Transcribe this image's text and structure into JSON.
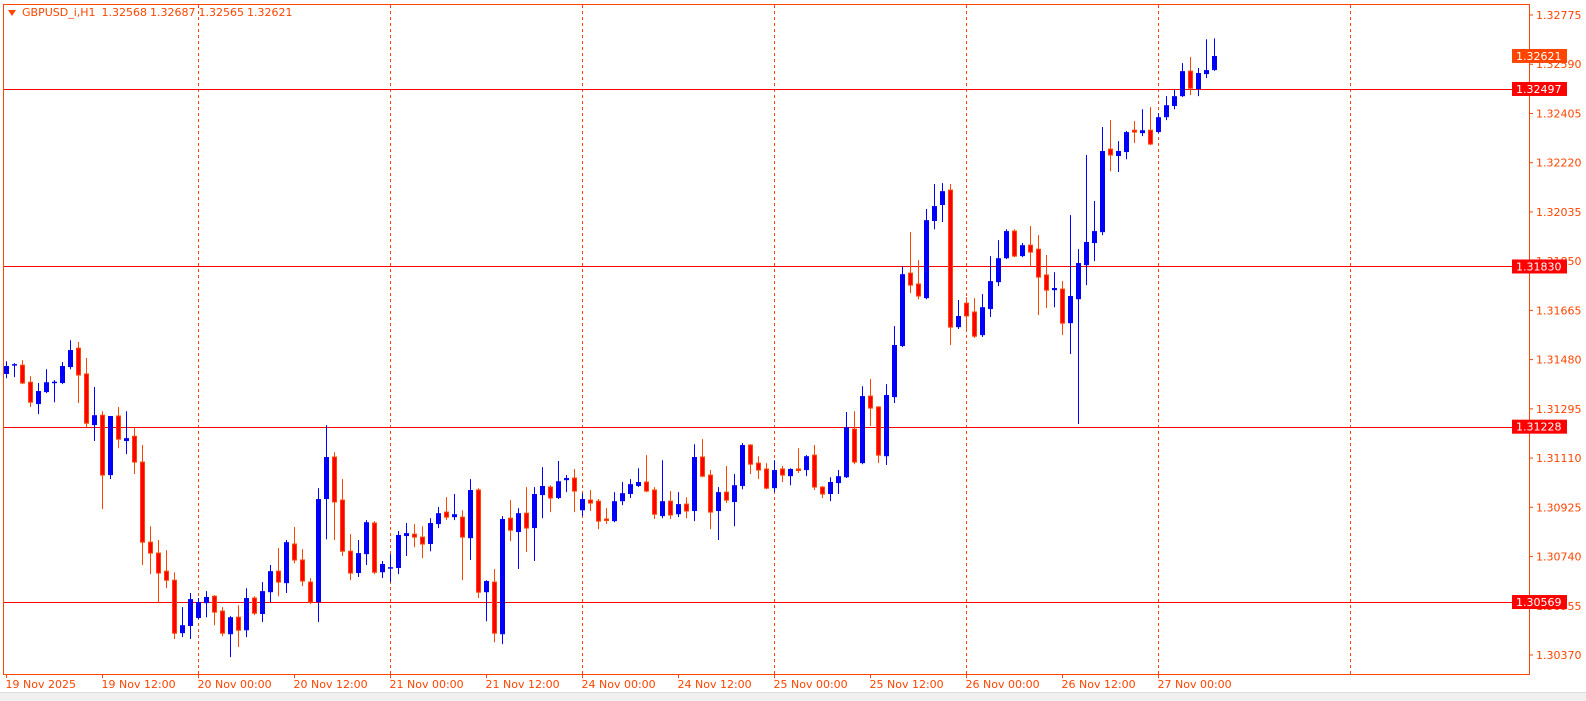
{
  "header": {
    "symbol": "GBPUSD_i,H1",
    "open": "1.32568",
    "high": "1.32687",
    "low": "1.32565",
    "close": "1.32621"
  },
  "colors": {
    "frame": "#FF4500",
    "bull": "#0000FF",
    "bear_fill": "#FF0000",
    "bear_outline": "#FF4500",
    "level_line": "#FF0000",
    "bid_label": "#FF4500",
    "background": "#FFFFFF"
  },
  "chart_data": {
    "type": "candlestick",
    "symbol": "GBPUSD_i",
    "timeframe": "H1",
    "ylim": [
      1.30355,
      1.32831
    ],
    "grid": false,
    "y_ticks": [
      "1.32775",
      "1.32590",
      "1.32405",
      "1.32220",
      "1.32035",
      "1.31850",
      "1.31665",
      "1.31480",
      "1.31295",
      "1.31110",
      "1.30925",
      "1.30740",
      "1.30555",
      "1.30370"
    ],
    "x_tick_labels": [
      "19 Nov 2025",
      "19 Nov 12:00",
      "20 Nov 00:00",
      "20 Nov 12:00",
      "21 Nov 00:00",
      "21 Nov 12:00",
      "24 Nov 00:00",
      "24 Nov 12:00",
      "25 Nov 00:00",
      "25 Nov 12:00",
      "26 Nov 00:00",
      "26 Nov 12:00",
      "27 Nov 00:00"
    ],
    "day_separators": [
      "20 Nov 00:00",
      "21 Nov 00:00",
      "24 Nov 00:00",
      "25 Nov 00:00",
      "26 Nov 00:00",
      "27 Nov 00:00",
      "28 Nov 00:00"
    ],
    "horizontal_levels": [
      {
        "price": 1.32497,
        "label": "1.32497"
      },
      {
        "price": 1.3183,
        "label": "1.31830"
      },
      {
        "price": 1.31228,
        "label": "1.31228"
      },
      {
        "price": 1.30569,
        "label": "1.30569"
      }
    ],
    "bid": {
      "price": 1.32621,
      "label": "1.32621"
    },
    "candles_columns": [
      "time",
      "open",
      "high",
      "low",
      "close"
    ],
    "candles": [
      [
        "19 Nov 00:00",
        1.31426,
        1.31474,
        1.3141,
        1.31456
      ],
      [
        "19 Nov 01:00",
        1.31461,
        1.31467,
        1.31414,
        1.31463
      ],
      [
        "19 Nov 02:00",
        1.31459,
        1.31478,
        1.31388,
        1.31392
      ],
      [
        "19 Nov 03:00",
        1.31395,
        1.31418,
        1.31302,
        1.3132
      ],
      [
        "19 Nov 04:00",
        1.31313,
        1.31392,
        1.31275,
        1.31362
      ],
      [
        "19 Nov 05:00",
        1.31358,
        1.31444,
        1.31354,
        1.31395
      ],
      [
        "19 Nov 06:00",
        1.31395,
        1.31403,
        1.3132,
        1.31397
      ],
      [
        "19 Nov 07:00",
        1.31392,
        1.31471,
        1.31388,
        1.31456
      ],
      [
        "19 Nov 08:00",
        1.31452,
        1.31553,
        1.31444,
        1.31516
      ],
      [
        "19 Nov 09:00",
        1.31523,
        1.31546,
        1.31317,
        1.31422
      ],
      [
        "19 Nov 10:00",
        1.31426,
        1.31486,
        1.31226,
        1.31241
      ],
      [
        "19 Nov 11:00",
        1.31234,
        1.31377,
        1.31174,
        1.31271
      ],
      [
        "19 Nov 12:00",
        1.31271,
        1.31286,
        1.30918,
        1.31046
      ],
      [
        "19 Nov 13:00",
        1.31046,
        1.31268,
        1.31031,
        1.31268
      ],
      [
        "19 Nov 14:00",
        1.31268,
        1.31302,
        1.31147,
        1.31181
      ],
      [
        "19 Nov 15:00",
        1.31174,
        1.31286,
        1.31125,
        1.31185
      ],
      [
        "19 Nov 16:00",
        1.31192,
        1.31226,
        1.3105,
        1.31095
      ],
      [
        "19 Nov 17:00",
        1.31095,
        1.31159,
        1.30708,
        1.30794
      ],
      [
        "19 Nov 18:00",
        1.30794,
        1.30854,
        1.30674,
        1.30753
      ],
      [
        "19 Nov 19:00",
        1.30753,
        1.30802,
        1.30565,
        1.30678
      ],
      [
        "19 Nov 20:00",
        1.30685,
        1.30764,
        1.30621,
        1.30651
      ],
      [
        "19 Nov 21:00",
        1.30651,
        1.30681,
        1.3043,
        1.30452
      ],
      [
        "19 Nov 22:00",
        1.30452,
        1.3055,
        1.30437,
        1.30482
      ],
      [
        "19 Nov 23:00",
        1.30479,
        1.30603,
        1.3043,
        1.3058
      ],
      [
        "20 Nov 00:00",
        1.30509,
        1.30584,
        1.30505,
        1.30569
      ],
      [
        "20 Nov 01:00",
        1.30565,
        1.3061,
        1.30512,
        1.30588
      ],
      [
        "20 Nov 02:00",
        1.30591,
        1.30595,
        1.30482,
        1.30531
      ],
      [
        "20 Nov 03:00",
        1.30535,
        1.3055,
        1.30441,
        1.30452
      ],
      [
        "20 Nov 04:00",
        1.30448,
        1.30516,
        1.30362,
        1.30512
      ],
      [
        "20 Nov 05:00",
        1.30512,
        1.30557,
        1.304,
        1.30463
      ],
      [
        "20 Nov 06:00",
        1.30463,
        1.30621,
        1.30437,
        1.30584
      ],
      [
        "20 Nov 07:00",
        1.30584,
        1.30591,
        1.3052,
        1.30527
      ],
      [
        "20 Nov 08:00",
        1.30524,
        1.30644,
        1.30494,
        1.3061
      ],
      [
        "20 Nov 09:00",
        1.30606,
        1.30708,
        1.30569,
        1.30685
      ],
      [
        "20 Nov 10:00",
        1.30685,
        1.30772,
        1.30591,
        1.30644
      ],
      [
        "20 Nov 11:00",
        1.3064,
        1.30802,
        1.30603,
        1.30794
      ],
      [
        "20 Nov 12:00",
        1.30787,
        1.30851,
        1.30715,
        1.30727
      ],
      [
        "20 Nov 13:00",
        1.30727,
        1.30768,
        1.30629,
        1.30648
      ],
      [
        "20 Nov 14:00",
        1.30644,
        1.30659,
        1.30561,
        1.30569
      ],
      [
        "20 Nov 15:00",
        1.30569,
        1.30997,
        1.30494,
        1.30956
      ],
      [
        "20 Nov 16:00",
        1.30956,
        1.31234,
        1.30805,
        1.31114
      ],
      [
        "20 Nov 17:00",
        1.31114,
        1.31132,
        1.30802,
        1.30945
      ],
      [
        "20 Nov 18:00",
        1.30952,
        1.31031,
        1.30742,
        1.3076
      ],
      [
        "20 Nov 19:00",
        1.3076,
        1.30824,
        1.30651,
        1.30678
      ],
      [
        "20 Nov 20:00",
        1.30678,
        1.30802,
        1.30663,
        1.30753
      ],
      [
        "20 Nov 21:00",
        1.30749,
        1.30877,
        1.30708,
        1.30869
      ],
      [
        "20 Nov 22:00",
        1.30866,
        1.30873,
        1.30674,
        1.30681
      ],
      [
        "20 Nov 23:00",
        1.30681,
        1.30723,
        1.30659,
        1.30712
      ],
      [
        "21 Nov 00:00",
        1.30697,
        1.30749,
        1.30644,
        1.307
      ],
      [
        "21 Nov 01:00",
        1.30697,
        1.30836,
        1.30674,
        1.30821
      ],
      [
        "21 Nov 02:00",
        1.30817,
        1.30866,
        1.30742,
        1.30828
      ],
      [
        "21 Nov 03:00",
        1.30824,
        1.30862,
        1.30775,
        1.30813
      ],
      [
        "21 Nov 04:00",
        1.30813,
        1.30854,
        1.30734,
        1.30787
      ],
      [
        "21 Nov 05:00",
        1.30787,
        1.30884,
        1.3076,
        1.30866
      ],
      [
        "21 Nov 06:00",
        1.30862,
        1.30926,
        1.30847,
        1.30903
      ],
      [
        "21 Nov 07:00",
        1.30907,
        1.30963,
        1.30877,
        1.30888
      ],
      [
        "21 Nov 08:00",
        1.30888,
        1.30975,
        1.30877,
        1.30899
      ],
      [
        "21 Nov 09:00",
        1.30888,
        1.30914,
        1.30651,
        1.30813
      ],
      [
        "21 Nov 10:00",
        1.30809,
        1.31031,
        1.30727,
        1.3099
      ],
      [
        "21 Nov 11:00",
        1.3099,
        1.30997,
        1.30584,
        1.30606
      ],
      [
        "21 Nov 12:00",
        1.30606,
        1.30651,
        1.30497,
        1.30648
      ],
      [
        "21 Nov 13:00",
        1.30644,
        1.30693,
        1.30418,
        1.30452
      ],
      [
        "21 Nov 14:00",
        1.30448,
        1.30892,
        1.30411,
        1.30881
      ],
      [
        "21 Nov 15:00",
        1.30884,
        1.30952,
        1.30798,
        1.30839
      ],
      [
        "21 Nov 16:00",
        1.30832,
        1.30922,
        1.30693,
        1.30903
      ],
      [
        "21 Nov 17:00",
        1.30903,
        1.31001,
        1.30757,
        1.30847
      ],
      [
        "21 Nov 18:00",
        1.30847,
        1.31001,
        1.30723,
        1.30975
      ],
      [
        "21 Nov 19:00",
        1.30971,
        1.31076,
        1.30884,
        1.31005
      ],
      [
        "21 Nov 20:00",
        1.31001,
        1.31008,
        1.30907,
        1.3096
      ],
      [
        "21 Nov 21:00",
        1.3096,
        1.31099,
        1.30956,
        1.31023
      ],
      [
        "21 Nov 22:00",
        1.31027,
        1.31046,
        1.30982,
        1.31035
      ],
      [
        "21 Nov 23:00",
        1.31035,
        1.31069,
        1.30907,
        1.30986
      ],
      [
        "24 Nov 00:00",
        1.30914,
        1.30978,
        1.30892,
        1.30956
      ],
      [
        "24 Nov 01:00",
        1.30952,
        1.3099,
        1.30911,
        1.30941
      ],
      [
        "24 Nov 02:00",
        1.30948,
        1.30956,
        1.30843,
        1.30873
      ],
      [
        "24 Nov 03:00",
        1.30881,
        1.30922,
        1.30862,
        1.30879
      ],
      [
        "24 Nov 04:00",
        1.30873,
        1.30982,
        1.30869,
        1.30948
      ],
      [
        "24 Nov 05:00",
        1.30948,
        1.3102,
        1.30933,
        1.30978
      ],
      [
        "24 Nov 06:00",
        1.30975,
        1.31031,
        1.3096,
        1.31012
      ],
      [
        "24 Nov 07:00",
        1.31005,
        1.31072,
        1.31001,
        1.3102
      ],
      [
        "24 Nov 08:00",
        1.3102,
        1.31121,
        1.30982,
        1.30986
      ],
      [
        "24 Nov 09:00",
        1.3099,
        1.31001,
        1.30881,
        1.30899
      ],
      [
        "24 Nov 10:00",
        1.30892,
        1.31102,
        1.30884,
        1.30948
      ],
      [
        "24 Nov 11:00",
        1.30948,
        1.30986,
        1.30881,
        1.30896
      ],
      [
        "24 Nov 12:00",
        1.30899,
        1.30982,
        1.30888,
        1.30937
      ],
      [
        "24 Nov 13:00",
        1.30937,
        1.30963,
        1.30884,
        1.30911
      ],
      [
        "24 Nov 14:00",
        1.30911,
        1.31162,
        1.30873,
        1.31114
      ],
      [
        "24 Nov 15:00",
        1.31114,
        1.31181,
        1.31038,
        1.31042
      ],
      [
        "24 Nov 16:00",
        1.31046,
        1.31065,
        1.30843,
        1.30907
      ],
      [
        "24 Nov 17:00",
        1.30911,
        1.31001,
        1.30802,
        1.30982
      ],
      [
        "24 Nov 18:00",
        1.30982,
        1.3108,
        1.30941,
        1.30952
      ],
      [
        "24 Nov 19:00",
        1.30945,
        1.3105,
        1.30854,
        1.31008
      ],
      [
        "24 Nov 20:00",
        1.31005,
        1.31166,
        1.30993,
        1.31159
      ],
      [
        "24 Nov 21:00",
        1.31159,
        1.31162,
        1.3105,
        1.31087
      ],
      [
        "24 Nov 22:00",
        1.31091,
        1.31117,
        1.31031,
        1.31065
      ],
      [
        "24 Nov 23:00",
        1.31069,
        1.31091,
        1.30993,
        1.30997
      ],
      [
        "25 Nov 00:00",
        1.30997,
        1.31102,
        1.30982,
        1.31065
      ],
      [
        "25 Nov 01:00",
        1.31069,
        1.3108,
        1.3102,
        1.31046
      ],
      [
        "25 Nov 02:00",
        1.31042,
        1.31072,
        1.31008,
        1.31069
      ],
      [
        "25 Nov 03:00",
        1.31069,
        1.31147,
        1.31054,
        1.31067
      ],
      [
        "25 Nov 04:00",
        1.31065,
        1.31121,
        1.31042,
        1.31117
      ],
      [
        "25 Nov 05:00",
        1.31121,
        1.31159,
        1.3099,
        1.31001
      ],
      [
        "25 Nov 06:00",
        1.31001,
        1.31005,
        1.3096,
        1.30975
      ],
      [
        "25 Nov 07:00",
        1.30975,
        1.31038,
        1.30948,
        1.3102
      ],
      [
        "25 Nov 08:00",
        1.31016,
        1.31065,
        1.30975,
        1.31042
      ],
      [
        "25 Nov 09:00",
        1.31038,
        1.31283,
        1.31035,
        1.31226
      ],
      [
        "25 Nov 10:00",
        1.31219,
        1.31286,
        1.31087,
        1.31095
      ],
      [
        "25 Nov 11:00",
        1.31091,
        1.3138,
        1.31087,
        1.31343
      ],
      [
        "25 Nov 12:00",
        1.31343,
        1.31407,
        1.3123,
        1.31298
      ],
      [
        "25 Nov 13:00",
        1.31302,
        1.31305,
        1.31091,
        1.31121
      ],
      [
        "25 Nov 14:00",
        1.31117,
        1.31388,
        1.31084,
        1.31347
      ],
      [
        "25 Nov 15:00",
        1.31339,
        1.31606,
        1.31317,
        1.31535
      ],
      [
        "25 Nov 16:00",
        1.31531,
        1.31831,
        1.31527,
        1.31801
      ],
      [
        "25 Nov 17:00",
        1.31805,
        1.31959,
        1.3173,
        1.3176
      ],
      [
        "25 Nov 18:00",
        1.31764,
        1.31854,
        1.31707,
        1.31719
      ],
      [
        "25 Nov 19:00",
        1.31711,
        1.32046,
        1.31707,
        1.32004
      ],
      [
        "25 Nov 20:00",
        1.32001,
        1.3214,
        1.3197,
        1.32057
      ],
      [
        "25 Nov 21:00",
        1.32061,
        1.32143,
        1.31997,
        1.32113
      ],
      [
        "25 Nov 22:00",
        1.32117,
        1.3214,
        1.31535,
        1.31602
      ],
      [
        "25 Nov 23:00",
        1.31602,
        1.31704,
        1.31595,
        1.31644
      ],
      [
        "26 Nov 00:00",
        1.31692,
        1.31715,
        1.31587,
        1.31644
      ],
      [
        "26 Nov 01:00",
        1.31659,
        1.31711,
        1.31561,
        1.31568
      ],
      [
        "26 Nov 02:00",
        1.31572,
        1.31726,
        1.31565,
        1.31677
      ],
      [
        "26 Nov 03:00",
        1.3167,
        1.31869,
        1.3164,
        1.31775
      ],
      [
        "26 Nov 04:00",
        1.31771,
        1.31929,
        1.31756,
        1.31861
      ],
      [
        "26 Nov 05:00",
        1.31861,
        1.3197,
        1.31858,
        1.31963
      ],
      [
        "26 Nov 06:00",
        1.31963,
        1.3197,
        1.31865,
        1.31869
      ],
      [
        "26 Nov 07:00",
        1.31869,
        1.31918,
        1.31865,
        1.3191
      ],
      [
        "26 Nov 08:00",
        1.3191,
        1.31982,
        1.31831,
        1.31884
      ],
      [
        "26 Nov 09:00",
        1.31895,
        1.31948,
        1.31647,
        1.3179
      ],
      [
        "26 Nov 10:00",
        1.31798,
        1.31873,
        1.31674,
        1.31741
      ],
      [
        "26 Nov 11:00",
        1.31741,
        1.31809,
        1.31677,
        1.31749
      ],
      [
        "26 Nov 12:00",
        1.31745,
        1.31775,
        1.31572,
        1.31617
      ],
      [
        "26 Nov 13:00",
        1.31617,
        1.32023,
        1.31501,
        1.31719
      ],
      [
        "26 Nov 14:00",
        1.31707,
        1.31895,
        1.31238,
        1.31843
      ],
      [
        "26 Nov 15:00",
        1.31835,
        1.32249,
        1.3176,
        1.31922
      ],
      [
        "26 Nov 16:00",
        1.31918,
        1.32076,
        1.3185,
        1.31963
      ],
      [
        "26 Nov 17:00",
        1.31959,
        1.32354,
        1.31948,
        1.32264
      ],
      [
        "26 Nov 18:00",
        1.32271,
        1.3238,
        1.32188,
        1.32249
      ],
      [
        "26 Nov 19:00",
        1.32245,
        1.32301,
        1.32185,
        1.32264
      ],
      [
        "26 Nov 20:00",
        1.3226,
        1.32339,
        1.32233,
        1.32335
      ],
      [
        "26 Nov 21:00",
        1.32342,
        1.32376,
        1.32294,
        1.32335
      ],
      [
        "26 Nov 22:00",
        1.32331,
        1.32421,
        1.3232,
        1.32342
      ],
      [
        "26 Nov 23:00",
        1.32342,
        1.32429,
        1.32286,
        1.3229
      ],
      [
        "27 Nov 00:00",
        1.32335,
        1.32406,
        1.32331,
        1.32391
      ],
      [
        "27 Nov 01:00",
        1.32391,
        1.3247,
        1.3238,
        1.32436
      ],
      [
        "27 Nov 02:00",
        1.32433,
        1.32493,
        1.32421,
        1.3247
      ],
      [
        "27 Nov 03:00",
        1.3247,
        1.32594,
        1.32467,
        1.32564
      ],
      [
        "27 Nov 04:00",
        1.32564,
        1.32617,
        1.32474,
        1.325
      ],
      [
        "27 Nov 05:00",
        1.32497,
        1.32576,
        1.3247,
        1.32557
      ],
      [
        "27 Nov 06:00",
        1.32553,
        1.32684,
        1.32538,
        1.32568
      ],
      [
        "27 Nov 07:00",
        1.32568,
        1.32687,
        1.32565,
        1.32621
      ]
    ]
  }
}
